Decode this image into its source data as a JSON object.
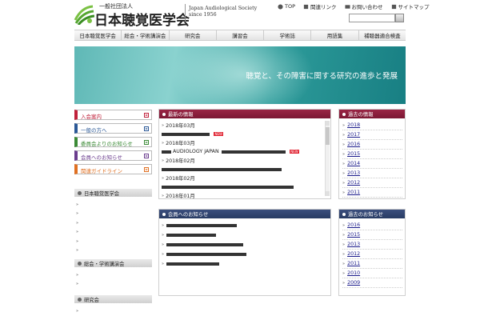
{
  "header": {
    "logo_small": "一般社団法人",
    "logo_big": "日本聴覚医学会",
    "logo_en_line1": "Japan Audiological Society",
    "logo_en_line2": "since 1956",
    "toplinks": [
      {
        "label": "TOP",
        "icon": "top-icon"
      },
      {
        "label": "関連リンク",
        "icon": "link-icon"
      },
      {
        "label": "お問い合わせ",
        "icon": "mail-icon"
      },
      {
        "label": "サイトマップ",
        "icon": "sitemap-icon"
      }
    ],
    "search_placeholder": ""
  },
  "nav": [
    "日本聴覚医学会",
    "総会・学術講演会",
    "研究会",
    "講習会",
    "学術誌",
    "用語集",
    "補聴器適合検査"
  ],
  "banner": {
    "text": "聴覚と、その障害に関する研究の進歩と発展"
  },
  "sidebar": {
    "buttons": [
      {
        "label": "入会案内"
      },
      {
        "label": "一般の方へ"
      },
      {
        "label": "委員会よりのお知らせ"
      },
      {
        "label": "会員へのお知らせ"
      },
      {
        "label": "関連ガイドライン"
      }
    ],
    "sections": [
      {
        "title": "日本聴覚医学会",
        "items": [
          "",
          "",
          "",
          "",
          "",
          ""
        ]
      },
      {
        "title": "総会・学術講演会",
        "items": [
          "",
          ""
        ]
      },
      {
        "title": "研究会",
        "items": [
          ""
        ]
      }
    ]
  },
  "latest_news": {
    "title": "最新の情報",
    "items": [
      {
        "text": "2018年03月",
        "new": false
      },
      {
        "text": "",
        "new": true
      },
      {
        "text": "2018年03月",
        "new": false
      },
      {
        "text": "AUDIOLOGY JAPAN",
        "new": true
      },
      {
        "text": "2018年02月",
        "new": false
      },
      {
        "text": "",
        "new": false
      },
      {
        "text": "2018年02月",
        "new": false
      },
      {
        "text": "",
        "new": false
      },
      {
        "text": "2018年01月",
        "new": false
      }
    ],
    "new_label": "NEW"
  },
  "past_info": {
    "title": "過去の情報",
    "years": [
      "2018",
      "2017",
      "2016",
      "2015",
      "2014",
      "2013",
      "2012",
      "2011"
    ]
  },
  "member_news": {
    "title": "会員へのお知らせ",
    "items": [
      "",
      "",
      "",
      "",
      ""
    ]
  },
  "past_notices": {
    "title": "過去のお知らせ",
    "years": [
      "2016",
      "2015",
      "2013",
      "2012",
      "2011",
      "2010",
      "2009"
    ]
  },
  "colors": {
    "accent_red": "#7b1733",
    "accent_blue": "#283b63",
    "banner": "#2d9b9a"
  }
}
